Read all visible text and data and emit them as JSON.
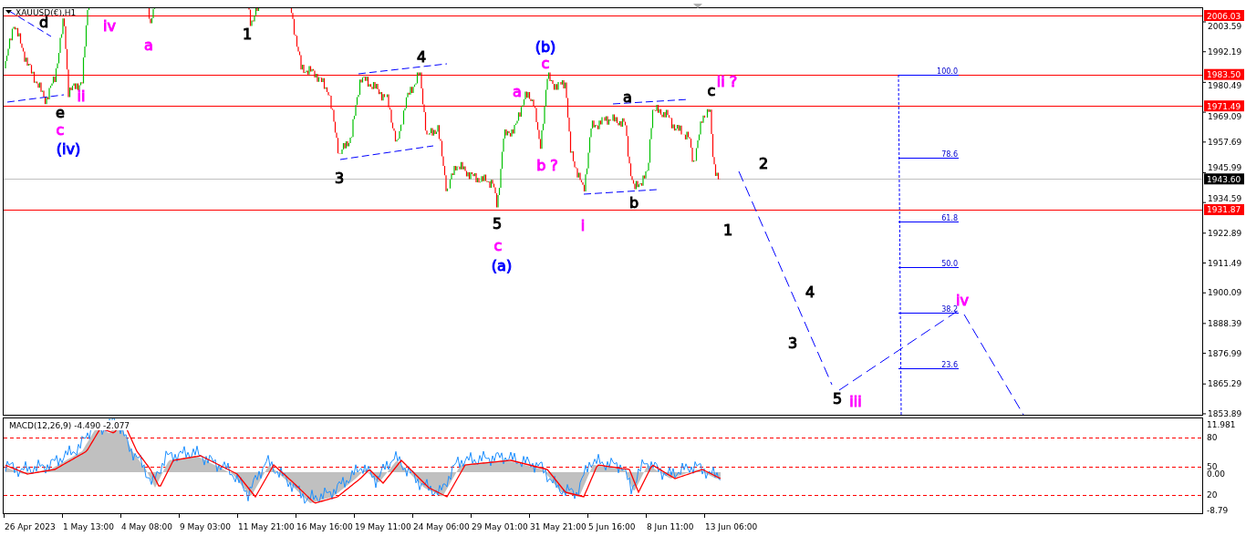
{
  "chart": {
    "title": "XAUUSD(€),H1",
    "price_axis": [
      "2003.59",
      "1992.19",
      "1980.49",
      "1969.09",
      "1957.69",
      "1945.99",
      "1934.59",
      "1922.89",
      "1911.49",
      "1900.09",
      "1888.39",
      "1876.99",
      "1865.29",
      "1853.89"
    ],
    "horizontal_lines": [
      {
        "label": "2006.03",
        "kind": "level"
      },
      {
        "label": "1983.50",
        "kind": "level"
      },
      {
        "label": "1971.49",
        "kind": "level"
      },
      {
        "label": "1943.60",
        "kind": "current"
      },
      {
        "label": "1931.87",
        "kind": "level"
      }
    ],
    "fib_levels": [
      "100.0",
      "78.6",
      "61.8",
      "50.0",
      "38.2",
      "23.6"
    ],
    "wave_labels": [
      {
        "text": "d",
        "color": "#000000"
      },
      {
        "text": "iv",
        "color": "#ff00ff"
      },
      {
        "text": "a",
        "color": "#ff00ff"
      },
      {
        "text": "1",
        "color": "#000000"
      },
      {
        "text": "e",
        "color": "#000000"
      },
      {
        "text": "ii",
        "color": "#ff00ff"
      },
      {
        "text": "c",
        "color": "#ff00ff"
      },
      {
        "text": "(iv)",
        "color": "#0000ff"
      },
      {
        "text": "4",
        "color": "#000000"
      },
      {
        "text": "(b)",
        "color": "#0000ff"
      },
      {
        "text": "c",
        "color": "#ff00ff"
      },
      {
        "text": "a",
        "color": "#ff00ff"
      },
      {
        "text": "a",
        "color": "#000000"
      },
      {
        "text": "c",
        "color": "#000000"
      },
      {
        "text": "ii ?",
        "color": "#ff00ff"
      },
      {
        "text": "3",
        "color": "#000000"
      },
      {
        "text": "b ?",
        "color": "#ff00ff"
      },
      {
        "text": "2",
        "color": "#000000"
      },
      {
        "text": "5",
        "color": "#000000"
      },
      {
        "text": "i",
        "color": "#ff00ff"
      },
      {
        "text": "b",
        "color": "#000000"
      },
      {
        "text": "1",
        "color": "#000000"
      },
      {
        "text": "c",
        "color": "#ff00ff"
      },
      {
        "text": "(a)",
        "color": "#0000ff"
      },
      {
        "text": "4",
        "color": "#000000"
      },
      {
        "text": "3",
        "color": "#000000"
      },
      {
        "text": "5",
        "color": "#000000"
      },
      {
        "text": "iii",
        "color": "#ff00ff"
      },
      {
        "text": "iv",
        "color": "#ff00ff"
      }
    ]
  },
  "macd": {
    "title": "MACD(12,26,9) -4.490 -2.077",
    "axis": [
      "11.981",
      "80",
      "50",
      "0.00",
      "20",
      "-8.79"
    ]
  },
  "time_axis": [
    "26 Apr 2023",
    "1 May 13:00",
    "4 May 08:00",
    "9 May 03:00",
    "11 May 21:00",
    "16 May 16:00",
    "19 May 11:00",
    "24 May 06:00",
    "29 May 01:00",
    "31 May 21:00",
    "5 Jun 16:00",
    "8 Jun 11:00",
    "13 Jun 06:00"
  ]
}
